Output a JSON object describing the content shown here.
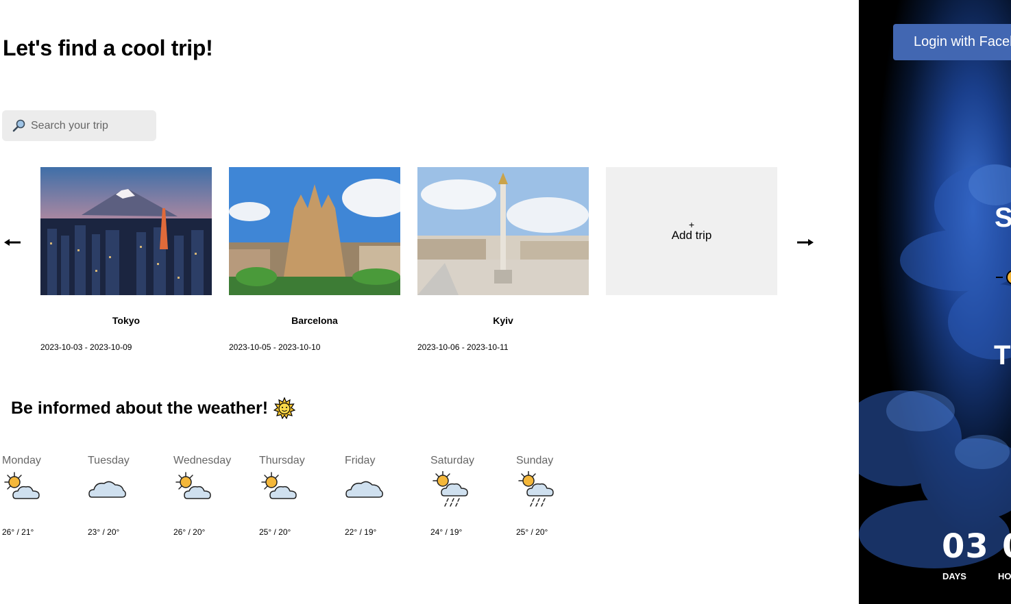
{
  "header": {
    "title": "Let's find a cool trip!"
  },
  "search": {
    "placeholder": "Search your trip",
    "icon": "search-icon"
  },
  "trips": [
    {
      "city": "Tokyo",
      "dates": "2023-10-03 - 2023-10-09"
    },
    {
      "city": "Barcelona",
      "dates": "2023-10-05 - 2023-10-10"
    },
    {
      "city": "Kyiv",
      "dates": "2023-10-06 - 2023-10-11"
    }
  ],
  "add_trip": {
    "plus": "+",
    "label": "Add trip"
  },
  "weather": {
    "title": "Be informed about the weather!",
    "days": [
      {
        "name": "Monday",
        "icon": "partly-cloudy",
        "temps": "26° / 21°"
      },
      {
        "name": "Tuesday",
        "icon": "cloudy",
        "temps": "23° / 20°"
      },
      {
        "name": "Wednesday",
        "icon": "partly-cloudy",
        "temps": "26° / 20°"
      },
      {
        "name": "Thursday",
        "icon": "partly-cloudy",
        "temps": "25° / 20°"
      },
      {
        "name": "Friday",
        "icon": "cloudy",
        "temps": "22° / 19°"
      },
      {
        "name": "Saturday",
        "icon": "sun-cloud-rain",
        "temps": "24° / 19°"
      },
      {
        "name": "Sunday",
        "icon": "sun-cloud-rain",
        "temps": "25° / 20°"
      }
    ]
  },
  "sidebar": {
    "login_label": "Login with Facebook",
    "partial_s": "S",
    "partial_t": "T",
    "countdown": {
      "days_value": "03",
      "days_label": "DAYS",
      "hours_partial": "0",
      "hours_label_partial": "HO"
    }
  },
  "colors": {
    "facebook_blue": "#4267b2",
    "search_bg": "#ececec",
    "add_trip_bg": "#f0f0f0"
  }
}
